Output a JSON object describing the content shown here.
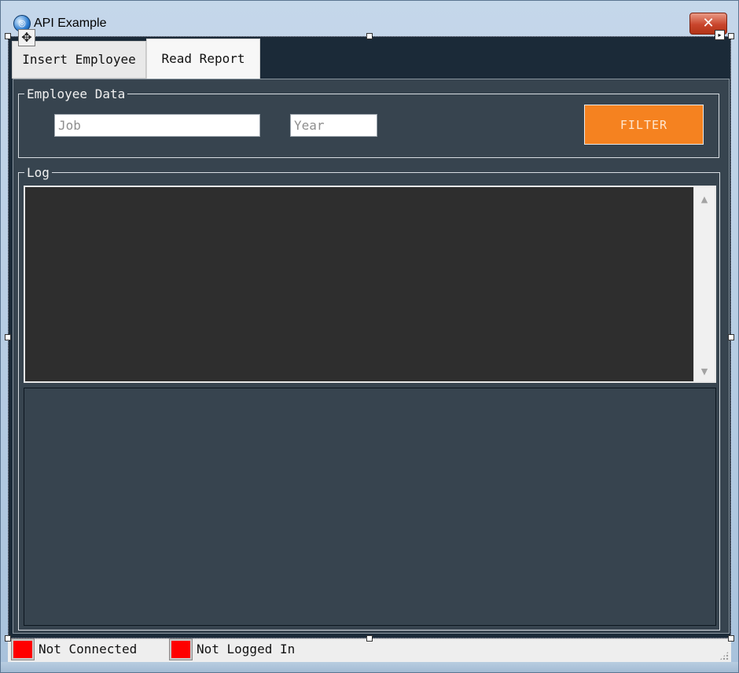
{
  "window": {
    "title": "API Example",
    "icon": "app-globe-icon",
    "close_glyph": "✕"
  },
  "designer": {
    "move_glyph": "✥",
    "smart_tag_glyph": "▸"
  },
  "tabs": [
    {
      "label": "Insert Employee",
      "selected": false
    },
    {
      "label": "Read Report",
      "selected": true
    }
  ],
  "employee_data": {
    "legend": "Employee Data",
    "job": {
      "placeholder": "Job",
      "value": ""
    },
    "year": {
      "placeholder": "Year",
      "value": ""
    },
    "filter_label": "FILTER"
  },
  "log": {
    "legend": "Log",
    "text": "",
    "scroll_up_glyph": "▲",
    "scroll_down_glyph": "▼"
  },
  "status": {
    "connection": "Not Connected",
    "login": "Not Logged In",
    "indicator_color": "#ff0000"
  },
  "colors": {
    "accent": "#f58220",
    "panel": "#37444f",
    "background": "#1b2a38",
    "log_background": "#2e2e2e"
  }
}
